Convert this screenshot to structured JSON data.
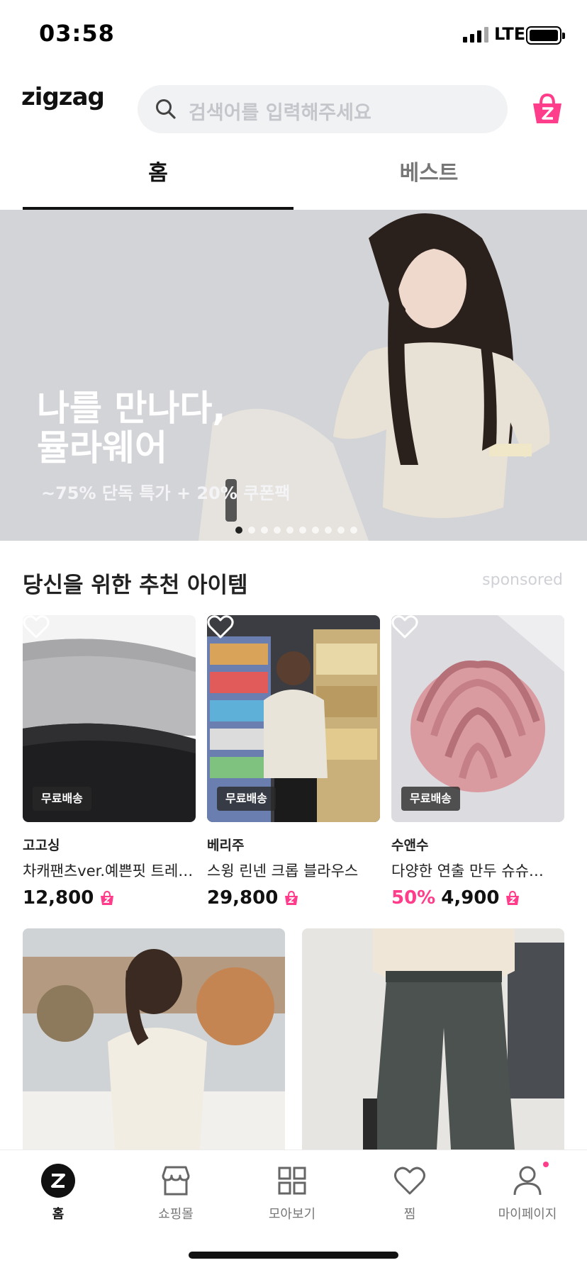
{
  "status_bar": {
    "time": "03:58",
    "network": "LTE"
  },
  "header": {
    "logo_text": "zigzag",
    "search_placeholder": "검색어를 입력해주세요"
  },
  "tabs": [
    {
      "label": "홈",
      "active": true
    },
    {
      "label": "베스트",
      "active": false
    }
  ],
  "banner": {
    "title": "나를 만나다,\n뮬라웨어",
    "subtitle": "~75% 단독 특가 + 20% 쿠폰팩",
    "slide_count": 10,
    "active_slide": 0
  },
  "section": {
    "title": "당신을 위한 추천 아이템",
    "sponsored_label": "sponsored"
  },
  "products": [
    {
      "badge": "무료배송",
      "shop": "고고싱",
      "name": "차캐팬츠ver.예쁜핏 트레…",
      "discount": "",
      "price": "12,800"
    },
    {
      "badge": "무료배송",
      "shop": "베리주",
      "name": "스윙 린넨 크롭 블라우스",
      "discount": "",
      "price": "29,800"
    },
    {
      "badge": "무료배송",
      "shop": "수앤수",
      "name": "다양한 연출 만두 슈슈…",
      "discount": "50%",
      "price": "4,900"
    }
  ],
  "bottom_nav": [
    {
      "label": "홈",
      "icon": "zigzag-home-icon",
      "active": true
    },
    {
      "label": "쇼핑몰",
      "icon": "store-icon",
      "active": false
    },
    {
      "label": "모아보기",
      "icon": "grid-icon",
      "active": false
    },
    {
      "label": "찜",
      "icon": "heart-icon",
      "active": false
    },
    {
      "label": "마이페이지",
      "icon": "person-icon",
      "active": false,
      "has_notification": true
    }
  ],
  "colors": {
    "brand_pink": "#ff3d8b",
    "text_dark": "#111111",
    "search_bg": "#f1f2f4"
  }
}
